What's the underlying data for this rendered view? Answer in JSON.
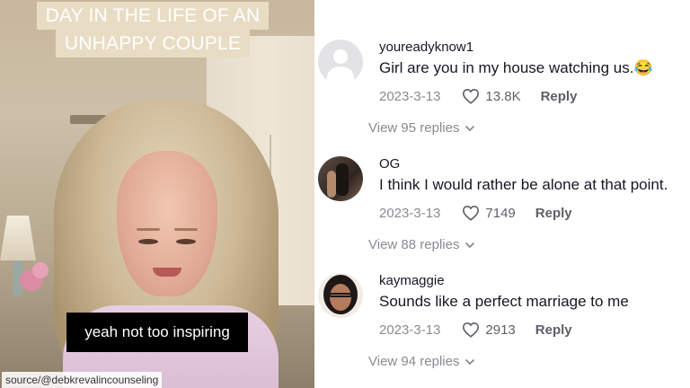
{
  "video": {
    "title_lines": [
      "DAY IN THE LIFE OF AN",
      "UNHAPPY COUPLE"
    ],
    "caption": "yeah not too inspiring",
    "source": "source/@debkrevalincounseling"
  },
  "colors": {
    "title_bg": "#e9dcc4",
    "caption_bg": "#000000",
    "text_primary": "#161823",
    "text_secondary": "#8a8b91"
  },
  "comments": [
    {
      "username": "youreadyknow1",
      "text": "Girl are you in my house watching us.😂",
      "date": "2023-3-13",
      "likes": "13.8K",
      "reply_label": "Reply",
      "view_replies": "View 95 replies",
      "avatar": "default-avatar-icon"
    },
    {
      "username": "OG",
      "text": "I think I would rather be alone at that point.",
      "date": "2023-3-13",
      "likes": "7149",
      "reply_label": "Reply",
      "view_replies": "View 88 replies",
      "avatar": "photo-avatar"
    },
    {
      "username": "kaymaggie",
      "text": "Sounds like a perfect marriage to me",
      "date": "2023-3-13",
      "likes": "2913",
      "reply_label": "Reply",
      "view_replies": "View 94 replies",
      "avatar": "photo-avatar"
    }
  ]
}
